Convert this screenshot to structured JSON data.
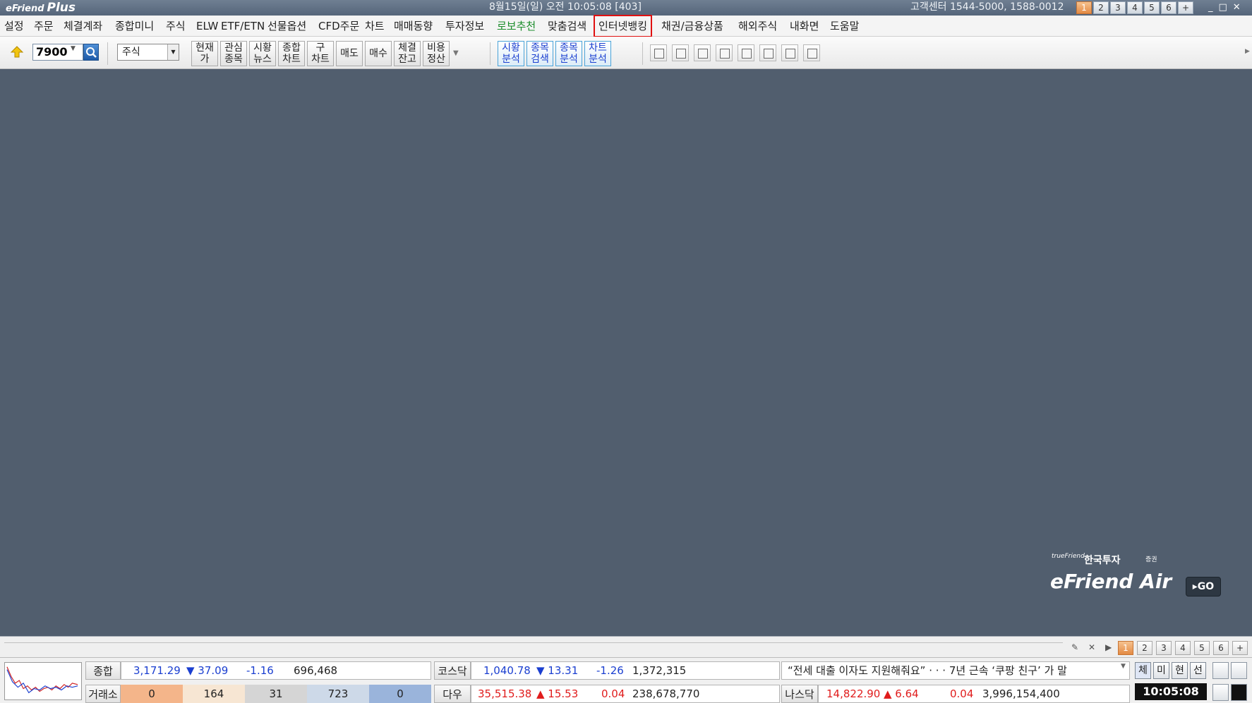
{
  "app": {
    "logo_part1": "eFriend",
    "logo_part2": "Plus",
    "datetime": "8월15일(일) 오전 10:05:08 [403]",
    "customer_center": "고객센터 1544-5000, 1588-0012",
    "screen_tabs": [
      "1",
      "2",
      "3",
      "4",
      "5",
      "6",
      "+"
    ],
    "window_controls": [
      "_",
      "□",
      "✕"
    ]
  },
  "menu": [
    {
      "label": "설정"
    },
    {
      "label": "주문"
    },
    {
      "label": "체결계좌"
    },
    {
      "label": "종합미니"
    },
    {
      "label": "주식"
    },
    {
      "label": "ELW"
    },
    {
      "label": "ETF/ETN"
    },
    {
      "label": "선물옵션"
    },
    {
      "label": "CFD주문"
    },
    {
      "label": "차트"
    },
    {
      "label": "매매동향"
    },
    {
      "label": "투자정보"
    },
    {
      "label": "로보추천"
    },
    {
      "label": "맞춤검색"
    },
    {
      "label": "인터넷뱅킹"
    },
    {
      "label": "채권/금융상품"
    },
    {
      "label": "해외주식"
    },
    {
      "label": "내화면"
    },
    {
      "label": "도움말"
    }
  ],
  "toolbar": {
    "stock_code": "7900",
    "market_type": "주식",
    "buttons": [
      {
        "label": "현재\n가"
      },
      {
        "label": "관심\n종목"
      },
      {
        "label": "시황\n뉴스"
      },
      {
        "label": "종합\n차트"
      },
      {
        "label": "구\n차트"
      },
      {
        "label": "매도"
      },
      {
        "label": "매수"
      },
      {
        "label": "체결\n잔고"
      },
      {
        "label": "비용\n정산"
      }
    ],
    "analysis_buttons": [
      {
        "label": "시황\n분석"
      },
      {
        "label": "종목\n검색"
      },
      {
        "label": "종목\n분석"
      },
      {
        "label": "차트\n분석"
      }
    ],
    "icons": [
      "tv-icon",
      "layout-icon",
      "note-icon",
      "back-screen-icon",
      "save-icon",
      "calculator-icon",
      "print-icon",
      "clock-icon"
    ]
  },
  "brand": {
    "small": "trueFriend",
    "korean": "한국투자",
    "korean_suffix": "증권",
    "product": "eFriend Air",
    "go": "▸GO"
  },
  "page_tabs": [
    "1",
    "2",
    "3",
    "4",
    "5",
    "6",
    "+"
  ],
  "ticker": {
    "kospi": {
      "label": "종합",
      "value": "3,171.29",
      "change": "▼ 37.09",
      "pct": "-1.16",
      "volume": "696,468"
    },
    "exchange": {
      "label": "거래소",
      "v1": "0",
      "v2": "164",
      "v3": "31",
      "v4": "723",
      "v5": "0"
    },
    "kosdaq": {
      "label": "코스닥",
      "value": "1,040.78",
      "change": "▼ 13.31",
      "pct": "-1.26",
      "volume": "1,372,315"
    },
    "dow": {
      "label": "다우",
      "value": "35,515.38",
      "change": "▲ 15.53",
      "pct": "0.04",
      "volume": "238,678,770"
    },
    "nasdaq": {
      "label": "나스닥",
      "value": "14,822.90",
      "change": "▲ 6.64",
      "pct": "0.04",
      "volume": "3,996,154,400"
    },
    "news": "“전세 대출 이자도 지원해줘요” · · · 7년 근속 ‘쿠팡 친구’ 가 말",
    "mini_buttons": [
      "체",
      "미",
      "현",
      "선"
    ],
    "clock": "10:05:08"
  },
  "colors": {
    "desktop": "#515e6e",
    "down": "#1b3fd0",
    "up": "#e01c1c",
    "highlight_box": "#e01010",
    "active_tab": "#e38a44"
  }
}
